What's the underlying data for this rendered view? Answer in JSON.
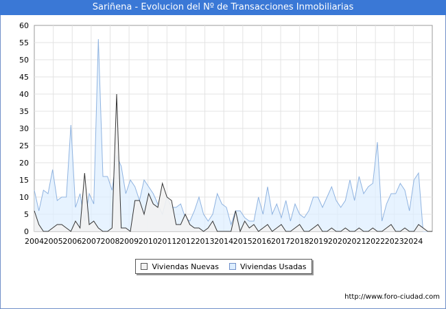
{
  "title": "Sariñena - Evolucion del Nº de Transacciones Inmobiliarias",
  "source": "http://www.foro-ciudad.com",
  "colors": {
    "title_bg": "#3a78d6",
    "nuevas_fill": "#f2f2f2",
    "nuevas_line": "#333333",
    "usadas_fill": "#ddeeff",
    "usadas_line": "#8fb3e0"
  },
  "chart_data": {
    "type": "area",
    "title": "Sariñena - Evolucion del Nº de Transacciones Inmobiliarias",
    "xlabel": "",
    "ylabel": "",
    "ylim": [
      0,
      60
    ],
    "yticks": [
      "0",
      "5",
      "10",
      "15",
      "20",
      "25",
      "30",
      "35",
      "40",
      "45",
      "50",
      "55",
      "60"
    ],
    "xticks": [
      "2004",
      "2005",
      "2006",
      "2007",
      "2008",
      "2009",
      "2010",
      "2011",
      "2012",
      "2013",
      "2014",
      "2015",
      "2016",
      "2017",
      "2018",
      "2019",
      "2020",
      "2021",
      "2022",
      "2023",
      "2024"
    ],
    "x_start": "2004 Q1",
    "x_end": "2024 Q4",
    "grid": true,
    "legend_position": "bottom-center",
    "series": [
      {
        "name": "Viviendas Nuevas",
        "values": [
          6,
          2,
          0,
          0,
          1,
          2,
          2,
          1,
          0,
          3,
          1,
          17,
          2,
          3,
          1,
          0,
          0,
          1,
          40,
          1,
          1,
          0,
          9,
          9,
          5,
          11,
          8,
          7,
          14,
          10,
          9,
          2,
          2,
          5,
          2,
          1,
          1,
          0,
          1,
          3,
          0,
          0,
          0,
          0,
          6,
          0,
          3,
          1,
          2,
          0,
          1,
          2,
          0,
          1,
          2,
          0,
          0,
          1,
          2,
          0,
          0,
          1,
          2,
          0,
          0,
          1,
          0,
          0,
          1,
          0,
          0,
          1,
          0,
          0,
          1,
          0,
          0,
          1,
          2,
          0,
          0,
          1,
          0,
          0,
          2,
          1,
          0,
          0
        ]
      },
      {
        "name": "Viviendas Usadas",
        "values": [
          12,
          6,
          12,
          11,
          18,
          9,
          10,
          10,
          31,
          7,
          11,
          3,
          11,
          8,
          56,
          16,
          16,
          12,
          22,
          19,
          11,
          15,
          13,
          9,
          15,
          13,
          11,
          8,
          5,
          10,
          7,
          7,
          8,
          4,
          3,
          6,
          10,
          5,
          3,
          5,
          11,
          8,
          7,
          2,
          6,
          6,
          4,
          3,
          3,
          10,
          5,
          13,
          5,
          8,
          4,
          9,
          3,
          8,
          5,
          4,
          6,
          10,
          10,
          7,
          10,
          13,
          9,
          7,
          9,
          15,
          9,
          16,
          11,
          13,
          14,
          26,
          3,
          8,
          11,
          11,
          14,
          12,
          6,
          15,
          17,
          0,
          0,
          0
        ]
      }
    ]
  },
  "legend": {
    "nuevas": "Viviendas Nuevas",
    "usadas": "Viviendas Usadas"
  }
}
